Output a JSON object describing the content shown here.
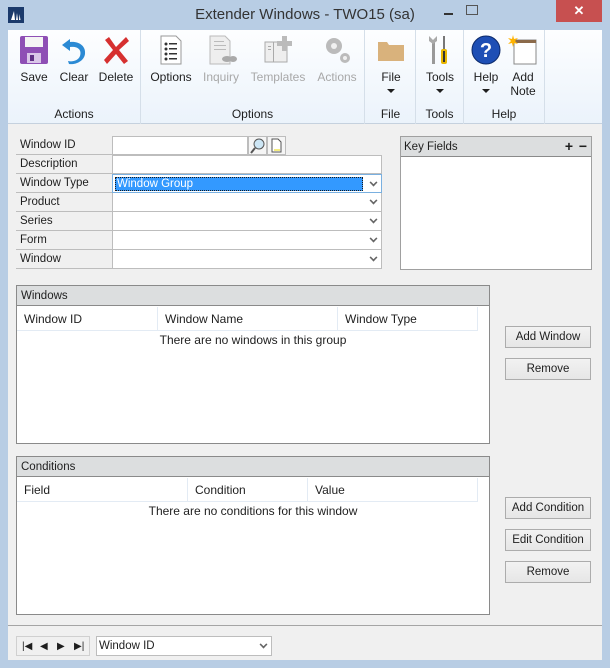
{
  "window": {
    "title": "Extender Windows  -  TWO15 (sa)",
    "close_glyph": "✕"
  },
  "ribbon": {
    "groups": [
      {
        "label": "Actions",
        "buttons": [
          {
            "label": "Save",
            "icon": "save-icon",
            "enabled": true
          },
          {
            "label": "Clear",
            "icon": "clear-icon",
            "enabled": true
          },
          {
            "label": "Delete",
            "icon": "delete-icon",
            "enabled": true
          }
        ]
      },
      {
        "label": "Options",
        "buttons": [
          {
            "label": "Options",
            "icon": "options-icon",
            "enabled": true
          },
          {
            "label": "Inquiry",
            "icon": "inquiry-icon",
            "enabled": false
          },
          {
            "label": "Templates",
            "icon": "templates-icon",
            "enabled": false
          },
          {
            "label": "Actions",
            "icon": "actions-icon",
            "enabled": false
          }
        ]
      },
      {
        "label": "File",
        "buttons": [
          {
            "label": "File",
            "icon": "folder-icon",
            "enabled": true,
            "dropdown": true
          }
        ]
      },
      {
        "label": "Tools",
        "buttons": [
          {
            "label": "Tools",
            "icon": "tools-icon",
            "enabled": true,
            "dropdown": true
          }
        ]
      },
      {
        "label": "Help",
        "buttons": [
          {
            "label": "Help",
            "icon": "help-icon",
            "enabled": true,
            "dropdown": true
          },
          {
            "label": "Add Note",
            "icon": "add-note-icon",
            "enabled": true
          }
        ]
      }
    ]
  },
  "form": {
    "fields": [
      {
        "label": "Window ID",
        "value": ""
      },
      {
        "label": "Description",
        "value": ""
      },
      {
        "label": "Window Type",
        "value": "Window Group"
      },
      {
        "label": "Product",
        "value": ""
      },
      {
        "label": "Series",
        "value": ""
      },
      {
        "label": "Form",
        "value": ""
      },
      {
        "label": "Window",
        "value": ""
      }
    ]
  },
  "key_fields": {
    "title": "Key Fields",
    "add": "+",
    "remove": "−"
  },
  "windows_panel": {
    "title": "Windows",
    "columns": [
      "Window ID",
      "Window Name",
      "Window Type"
    ],
    "empty_message": "There are no windows in this group",
    "buttons": {
      "add": "Add Window",
      "remove": "Remove"
    }
  },
  "conditions_panel": {
    "title": "Conditions",
    "columns": [
      "Field",
      "Condition",
      "Value"
    ],
    "empty_message": "There are no conditions for this window",
    "buttons": {
      "add": "Add Condition",
      "edit": "Edit Condition",
      "remove": "Remove"
    }
  },
  "statusbar": {
    "nav": {
      "first": "|◀",
      "prev": "◀",
      "next": "▶",
      "last": "▶|"
    },
    "sort_by": "Window ID"
  }
}
